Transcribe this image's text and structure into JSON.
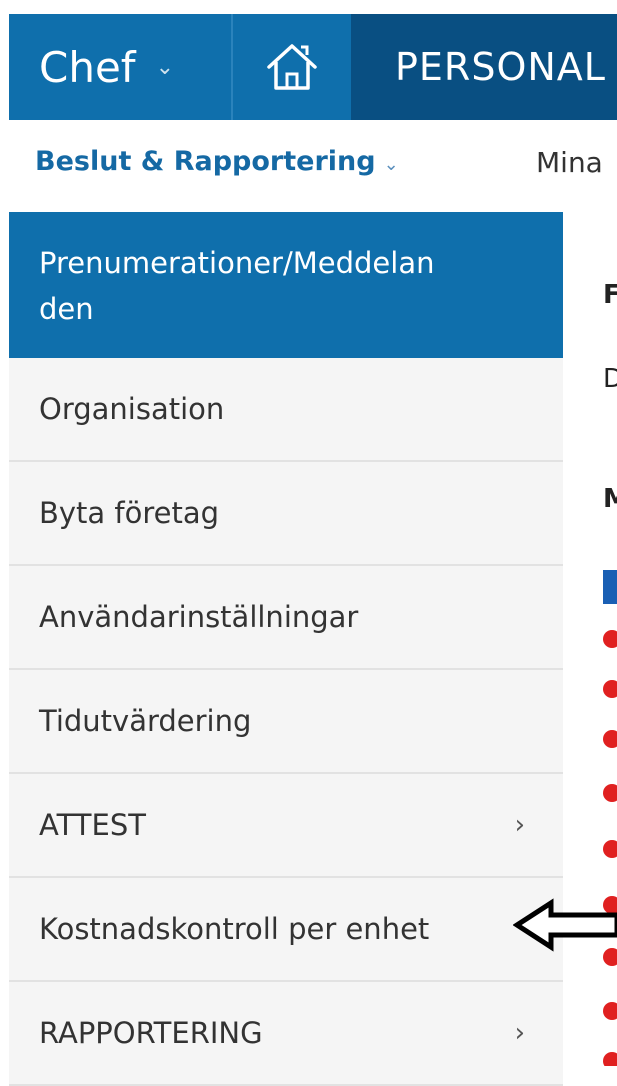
{
  "topbar": {
    "role_label": "Chef",
    "role_chevron": "⌄",
    "home_icon": "home-icon",
    "section_label": "PERSONAL"
  },
  "subnav": {
    "decision_label": "Beslut & Rapportering",
    "decision_chevron": "⌄",
    "mine_label": "Mina"
  },
  "sidebar": {
    "items": [
      {
        "label": "Prenumerationer/Meddelan den",
        "line1": "Prenumerationer/Meddelan",
        "line2": "den",
        "active": true
      },
      {
        "label": "Organisation"
      },
      {
        "label": "Byta företag"
      },
      {
        "label": "Användarinställningar"
      },
      {
        "label": "Tidutvärdering"
      },
      {
        "label": "ATTEST",
        "arrow": "›"
      },
      {
        "label": "Kostnadskontroll per enhet"
      },
      {
        "label": "RAPPORTERING",
        "arrow": "›"
      }
    ]
  },
  "content": {
    "clipped_1": "F",
    "clipped_2": "D",
    "clipped_3": "M",
    "highlight_color": "#1a5fb4",
    "dot_color": "#e02020"
  },
  "colors": {
    "primary": "#0f6fac",
    "primary_dark": "#094f82",
    "link": "#1569a4"
  }
}
